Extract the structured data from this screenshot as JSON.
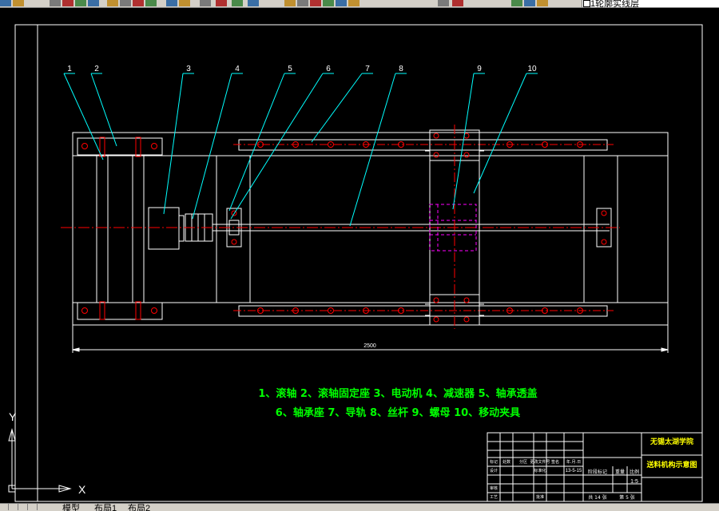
{
  "toolbar": {
    "layer": {
      "name": "1轮廓实线层",
      "swatch_color": "#ffffff"
    },
    "icons": [
      "open-icon",
      "save-icon",
      "print-icon",
      "preview-icon",
      "plot-icon",
      "cut-icon",
      "copy-icon",
      "paste-icon",
      "matchprop-icon",
      "brush-icon",
      "undo-icon",
      "redo-icon",
      "pan-icon",
      "zoom-realtime-icon",
      "zoom-window-icon",
      "zoom-previous-icon",
      "properties-icon",
      "designcenter-icon",
      "toolpalette-icon",
      "sheetset-icon",
      "markup-icon",
      "calculator-icon",
      "layer-manager-icon",
      "layer-state-icon",
      "bulb-icon",
      "sun-icon",
      "lock-icon"
    ]
  },
  "drawing": {
    "part_labels": [
      "1",
      "2",
      "3",
      "4",
      "5",
      "6",
      "7",
      "8",
      "9",
      "10"
    ],
    "dimension": "2500",
    "legend_line1": "1、滚轴  2、滚轴固定座 3、电动机  4、减速器  5、轴承透盖",
    "legend_line2": "6、轴承座  7、导轨  8、丝杆  9、螺母  10、移动夹具",
    "title_block": {
      "school": "无锡太湖学院",
      "drawing_title": "送料机构示意图",
      "scale_header": "比例",
      "scale": "1:5",
      "sheet_total": "共 14 张",
      "sheet_no": "第 5 张",
      "weight_header": "重量",
      "stage_header": "阶段标记",
      "row_labels": [
        "标记",
        "设计",
        "审核",
        "工艺"
      ],
      "row_labels_2": [
        "处数",
        "标准化",
        "",
        "批准"
      ],
      "col_headers": [
        "分区",
        "更改文件号",
        "签名",
        "年.月.日"
      ],
      "date": "13-5-15"
    },
    "ucs": {
      "x": "X",
      "y": "Y"
    }
  },
  "tabs": [
    "模型",
    "布局1",
    "布局2"
  ],
  "colors": {
    "outline": "#ffffff",
    "leader": "#00ffff",
    "centerline": "#ff0000",
    "hidden": "#ff00ff",
    "text_green": "#00ff00",
    "title_yellow": "#ffff00"
  }
}
